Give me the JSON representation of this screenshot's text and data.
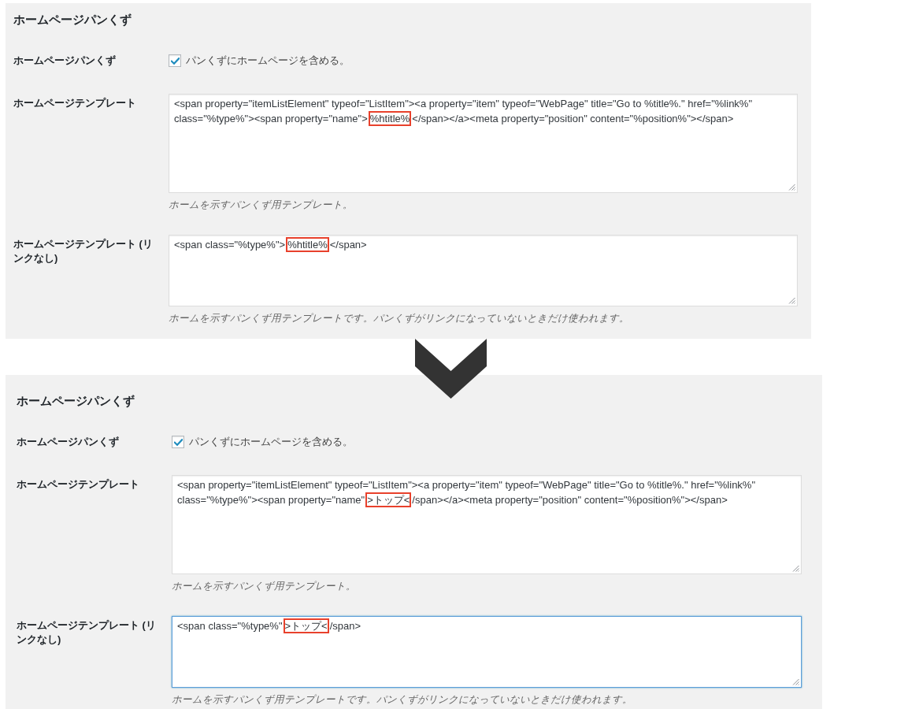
{
  "panels": [
    {
      "heading": "ホームページパンくず",
      "rows": [
        {
          "kind": "checkbox",
          "label": "ホームページパンくず",
          "option": "パンくずにホームページを含める。",
          "checked": true
        },
        {
          "kind": "textarea",
          "label": "ホームページテンプレート",
          "focused": false,
          "value_parts": [
            {
              "text": "<span property=\"itemListElement\" typeof=\"ListItem\"><a property=\"item\" typeof=\"WebPage\" title=\"Go to %title%.\" href=\"%link%\" class=\"%type%\"><span property=\"name\">",
              "highlighted": false
            },
            {
              "text": "%htitle%",
              "highlighted": true
            },
            {
              "text": "</span></a><meta property=\"position\" content=\"%position%\"></span>",
              "highlighted": false
            }
          ],
          "description": "ホームを示すパンくず用テンプレート。"
        },
        {
          "kind": "textarea",
          "label": "ホームページテンプレート (リンクなし)",
          "focused": false,
          "value_parts": [
            {
              "text": "<span class=\"%type%\">",
              "highlighted": false
            },
            {
              "text": "%htitle%",
              "highlighted": true
            },
            {
              "text": "</span>",
              "highlighted": false
            }
          ],
          "description": "ホームを示すパンくず用テンプレートです。パンくずがリンクになっていないときだけ使われます。"
        }
      ]
    },
    {
      "heading": "ホームページパンくず",
      "rows": [
        {
          "kind": "checkbox",
          "label": "ホームページパンくず",
          "option": "パンくずにホームページを含める。",
          "checked": true
        },
        {
          "kind": "textarea",
          "label": "ホームページテンプレート",
          "focused": false,
          "value_parts": [
            {
              "text": "<span property=\"itemListElement\" typeof=\"ListItem\"><a property=\"item\" typeof=\"WebPage\" title=\"Go to %title%.\" href=\"%link%\" class=\"%type%\"><span property=\"name\"",
              "highlighted": false
            },
            {
              "text": ">トップ<",
              "highlighted": true
            },
            {
              "text": "/span></a><meta property=\"position\" content=\"%position%\"></span>",
              "highlighted": false
            }
          ],
          "description": "ホームを示すパンくず用テンプレート。"
        },
        {
          "kind": "textarea",
          "label": "ホームページテンプレート (リンクなし)",
          "focused": true,
          "value_parts": [
            {
              "text": "<span class=\"%type%\"",
              "highlighted": false
            },
            {
              "text": ">トップ<",
              "highlighted": true
            },
            {
              "text": "/span>",
              "highlighted": false
            }
          ],
          "description": "ホームを示すパンくず用テンプレートです。パンくずがリンクになっていないときだけ使われます。"
        }
      ]
    }
  ]
}
